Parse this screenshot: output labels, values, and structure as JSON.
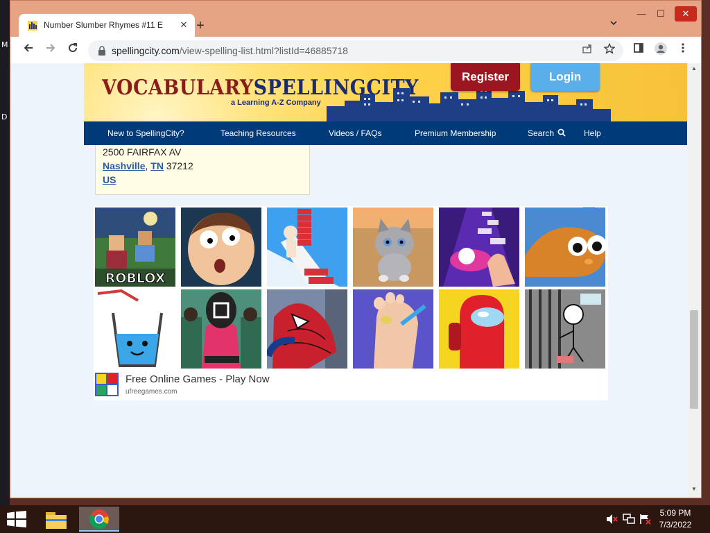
{
  "desktop": {
    "left_chars": [
      "M",
      "D"
    ]
  },
  "browser": {
    "tab_title": "Number Slumber Rhymes #11 E",
    "new_tab_label": "+",
    "close_tab_label": "✕",
    "window_controls": {
      "minimize": "—",
      "maximize": "☐",
      "close": "✕"
    },
    "url_domain": "spellingcity.com",
    "url_path": "/view-spelling-list.html?listId=46885718"
  },
  "site": {
    "logo_part1": "VOCABULARY",
    "logo_part2": "SPELLINGCITY",
    "tagline": "a Learning A-Z Company",
    "register_label": "Register",
    "login_label": "Login",
    "nav": [
      {
        "label": "New to SpellingCity?"
      },
      {
        "label": "Teaching Resources"
      },
      {
        "label": "Videos / FAQs"
      },
      {
        "label": "Premium Membership"
      },
      {
        "label": "Search"
      },
      {
        "label": "Help"
      }
    ]
  },
  "address": {
    "street": "2500 FAIRFAX AV",
    "city": "Nashville",
    "comma": ",",
    "state": "TN",
    "zip": "37212",
    "country": "US"
  },
  "ad": {
    "tiles_row1": [
      "ROBLOX",
      "",
      "",
      "",
      "",
      ""
    ],
    "footer_title": "Free Online Games - Play Now",
    "footer_url": "ufreegames.com"
  },
  "taskbar": {
    "time": "5:09 PM",
    "date": "7/3/2022"
  }
}
